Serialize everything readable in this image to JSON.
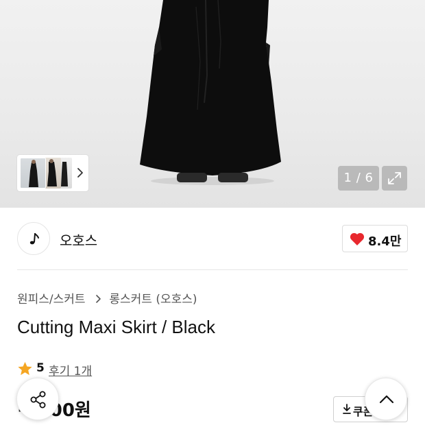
{
  "gallery": {
    "counter": "1 / 6",
    "current_image": 1,
    "total_images": 6
  },
  "icons": {
    "thumb_next": "chevron-right-icon",
    "expand": "expand-icon",
    "brand_logo": "music-note-logo",
    "like": "heart-icon",
    "breadcrumb_sep": "chevron-right-icon",
    "rating": "star-icon",
    "coupon": "download-icon",
    "share": "share-icon",
    "scroll_top": "chevron-up-icon"
  },
  "brand": {
    "name": "오호스",
    "like_count": "8.4만"
  },
  "breadcrumb": {
    "category": "원피스/스커트",
    "subcategory": "롱스커트 (오호스)"
  },
  "product": {
    "title": "Cutting Maxi Skirt / Black",
    "rating": "5",
    "reviews": "후기 1개",
    "price": "··,000원"
  },
  "coupon": {
    "label": "쿠폰"
  },
  "colors": {
    "heart": "#e8282e",
    "star": "#f5a623",
    "text": "#111111",
    "muted": "#555555",
    "overlay": "#969696"
  }
}
